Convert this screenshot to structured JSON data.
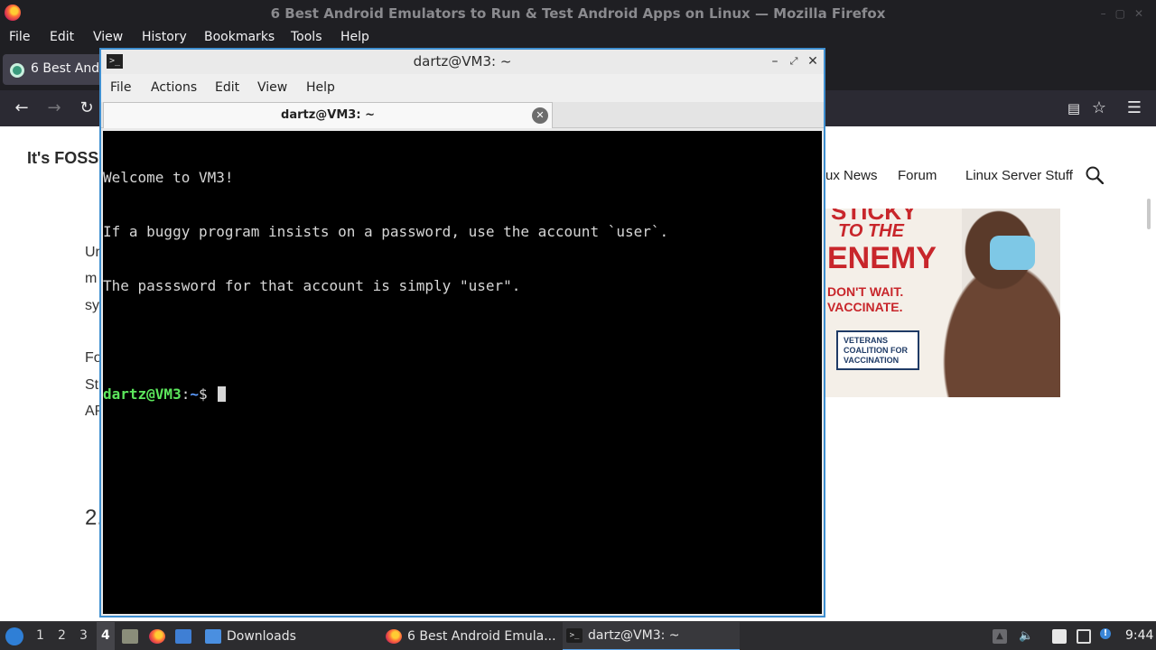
{
  "firefox": {
    "window_title": "6 Best Android Emulators to Run & Test Android Apps on Linux — Mozilla Firefox",
    "menu": [
      "File",
      "Edit",
      "View",
      "History",
      "Bookmarks",
      "Tools",
      "Help"
    ],
    "tab_label": "6 Best Andr",
    "nav_icons": [
      "back-arrow-icon",
      "forward-arrow-icon",
      "reload-icon",
      "reader-view-icon",
      "bookmark-star-icon",
      "hamburger-menu-icon"
    ]
  },
  "website": {
    "logo": "It's FOSS",
    "nav_items": [
      "ux News",
      "Forum",
      "Linux Server Stuff"
    ],
    "article_fragments": [
      "Ur",
      "m",
      "sy",
      "Fo",
      "St",
      "AP",
      "2."
    ],
    "ad": {
      "line1": "STICKY",
      "line2": "TO THE",
      "line3": "ENEMY",
      "line4": "DON'T WAIT.",
      "line5": "VACCINATE.",
      "badge": "VETERANS\nCOALITION FOR\nVACCINATION"
    }
  },
  "terminal": {
    "title": "dartz@VM3: ~",
    "menu": [
      "File",
      "Actions",
      "Edit",
      "View",
      "Help"
    ],
    "tab_label": "dartz@VM3: ~",
    "lines": [
      "Welcome to VM3!",
      "If a buggy program insists on a password, use the account `user`.",
      "The passsword for that account is simply \"user\".",
      ""
    ],
    "prompt_user": "dartz@VM3",
    "prompt_sep": ":",
    "prompt_path": "~",
    "prompt_symbol": "$ "
  },
  "taskbar": {
    "workspaces": [
      "1",
      "2",
      "3",
      "4"
    ],
    "active_workspace": "4",
    "tasks": [
      {
        "label": "Downloads",
        "icon": "folder-icon"
      },
      {
        "label": "6 Best Android Emula...",
        "icon": "firefox-icon"
      },
      {
        "label": "dartz@VM3: ~",
        "icon": "terminal-icon"
      }
    ],
    "clock": "9:44"
  }
}
